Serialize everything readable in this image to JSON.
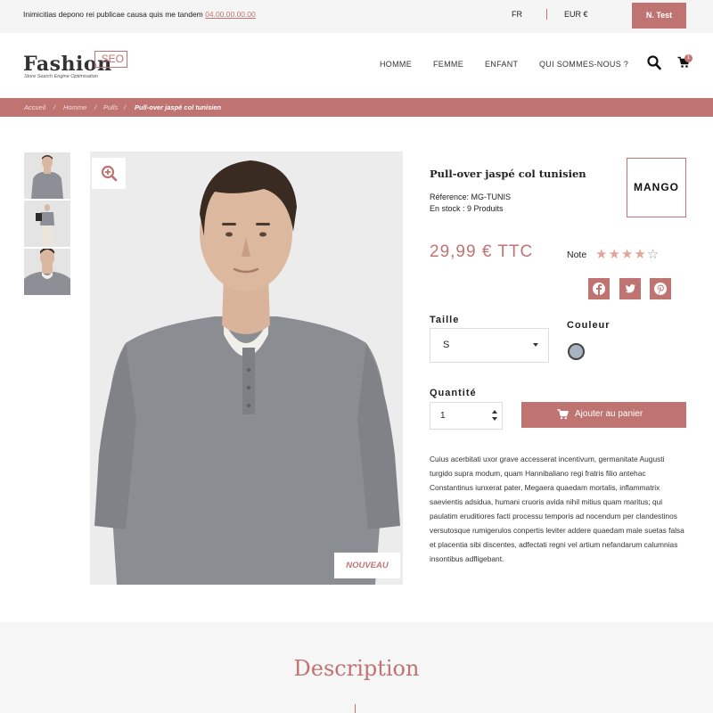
{
  "topbar": {
    "message": "Inimicitias depono rei publicae causa quis me tandem ",
    "phone": "04.00.00.00.00",
    "language": "FR",
    "currency": "EUR €",
    "account_label": "N. Test"
  },
  "header": {
    "logo_word": "Fashion",
    "logo_badge": "SEO",
    "logo_tagline": "Store Search Engine Optimisation",
    "nav": [
      "HOMME",
      "FEMME",
      "ENFANT",
      "QUI SOMMES-NOUS ?"
    ],
    "cart_count": "1"
  },
  "breadcrumb": {
    "items": [
      "Accueil",
      "Homme",
      "Pulls"
    ],
    "separator": "/",
    "current": "Pull-over jaspé col tunisien"
  },
  "gallery": {
    "badge": "NOUVEAU"
  },
  "product": {
    "title": "Pull-over jaspé col tunisien",
    "reference": "Réference: MG-TUNIS",
    "stock": "En stock : 9 Produits",
    "brand": "MANGO",
    "price": "29,99 € TTC",
    "rating_label": "Note",
    "rating": 4,
    "rating_max": 5,
    "size_label": "Taille",
    "size_value": "S",
    "color_label": "Couleur",
    "color_swatch": "#a9b4c2",
    "quantity_label": "Quantité",
    "quantity_value": "1",
    "add_to_cart": "Ajouter au panier",
    "description": "Cuius acerbitati uxor grave accesserat incentivum, germanitate Augusti turgido supra modum, quam Hannibaliano regi fratris filio antehac Constantinus iunxerat pater, Megaera quaedam mortalis, inflammatrix saevientis adsidua, humani cruoris avida nihil mitius quam maritus; qui paulatim eruditiores facti processu temporis ad nocendum per clandestinos versutosque rumigerulos conpertis leviter addere quaedam male suetas falsa et placentia sibi discentes, adfectati regni vel artium nefandarum calumnias insontibus adfligebant."
  },
  "section": {
    "description_title": "Description"
  },
  "colors": {
    "accent": "#c07472",
    "topbar_bg": "#f5f5f5",
    "section_bg": "#f6f6f6"
  }
}
